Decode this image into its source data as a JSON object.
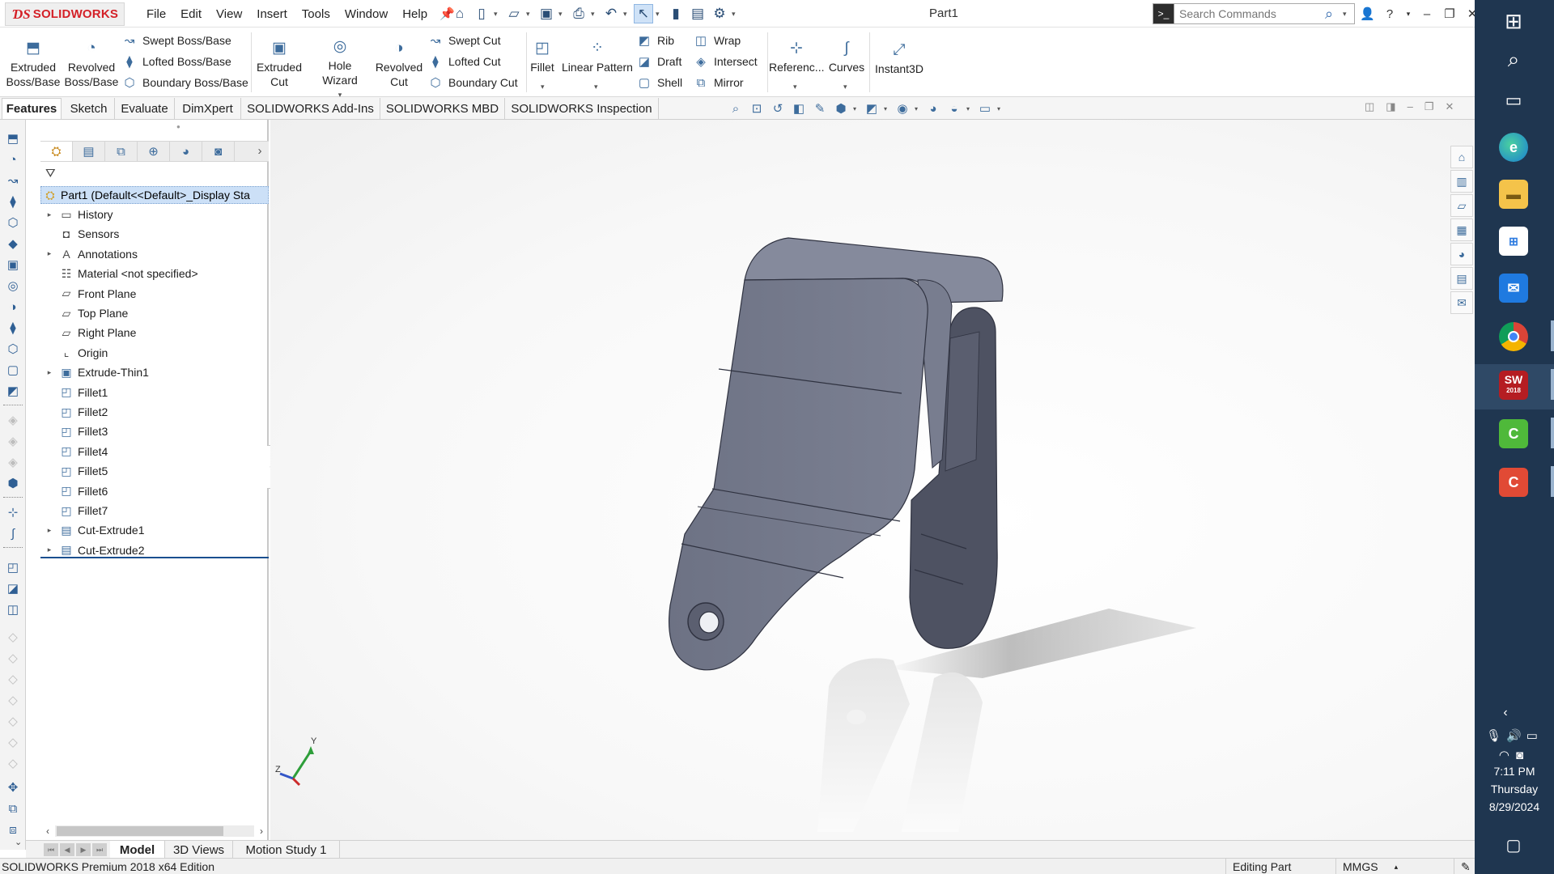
{
  "app": {
    "brand": "SOLIDWORKS",
    "document_title": "Part1",
    "menu": [
      "File",
      "Edit",
      "View",
      "Insert",
      "Tools",
      "Window",
      "Help"
    ],
    "search_placeholder": "Search Commands",
    "colors": {
      "brand_red": "#d42027",
      "selection_blue": "#cce0f7",
      "taskbar": "#1f3650",
      "model_gray": "#72778a"
    }
  },
  "ribbon": {
    "extruded_boss": "Extruded Boss/Base",
    "revolved_boss": "Revolved Boss/Base",
    "swept_boss": "Swept Boss/Base",
    "lofted_boss": "Lofted Boss/Base",
    "boundary_boss": "Boundary Boss/Base",
    "extruded_cut": "Extruded Cut",
    "hole_wizard": "Hole Wizard",
    "revolved_cut": "Revolved Cut",
    "swept_cut": "Swept Cut",
    "lofted_cut": "Lofted Cut",
    "boundary_cut": "Boundary Cut",
    "fillet": "Fillet",
    "linear_pattern": "Linear Pattern",
    "rib": "Rib",
    "draft": "Draft",
    "shell": "Shell",
    "wrap": "Wrap",
    "intersect": "Intersect",
    "mirror": "Mirror",
    "reference": "Referenc...",
    "curves": "Curves",
    "instant3d": "Instant3D"
  },
  "tabs": [
    "Features",
    "Sketch",
    "Evaluate",
    "DimXpert",
    "SOLIDWORKS Add-Ins",
    "SOLIDWORKS MBD",
    "SOLIDWORKS Inspection"
  ],
  "feature_tree": {
    "root": "Part1  (Default<<Default>_Display Sta",
    "items": [
      {
        "label": "History",
        "icon": "history-folder-icon",
        "expandable": true
      },
      {
        "label": "Sensors",
        "icon": "sensors-icon",
        "expandable": false
      },
      {
        "label": "Annotations",
        "icon": "annotations-icon",
        "expandable": true
      },
      {
        "label": "Material <not specified>",
        "icon": "material-icon",
        "expandable": false
      },
      {
        "label": "Front Plane",
        "icon": "plane-icon",
        "expandable": false
      },
      {
        "label": "Top Plane",
        "icon": "plane-icon",
        "expandable": false
      },
      {
        "label": "Right Plane",
        "icon": "plane-icon",
        "expandable": false
      },
      {
        "label": "Origin",
        "icon": "origin-icon",
        "expandable": false
      },
      {
        "label": "Extrude-Thin1",
        "icon": "extrude-icon",
        "expandable": true
      },
      {
        "label": "Fillet1",
        "icon": "fillet-icon",
        "expandable": false
      },
      {
        "label": "Fillet2",
        "icon": "fillet-icon",
        "expandable": false
      },
      {
        "label": "Fillet3",
        "icon": "fillet-icon",
        "expandable": false
      },
      {
        "label": "Fillet4",
        "icon": "fillet-icon",
        "expandable": false
      },
      {
        "label": "Fillet5",
        "icon": "fillet-icon",
        "expandable": false
      },
      {
        "label": "Fillet6",
        "icon": "fillet-icon",
        "expandable": false
      },
      {
        "label": "Fillet7",
        "icon": "fillet-icon",
        "expandable": false
      },
      {
        "label": "Cut-Extrude1",
        "icon": "cut-extrude-icon",
        "expandable": true
      },
      {
        "label": "Cut-Extrude2",
        "icon": "cut-extrude-icon",
        "expandable": true
      }
    ]
  },
  "bottom_tabs": [
    "Model",
    "3D Views",
    "Motion Study 1"
  ],
  "status": {
    "edition": "SOLIDWORKS Premium 2018 x64 Edition",
    "mode": "Editing Part",
    "units": "MMGS"
  },
  "triad": {
    "y": "Y",
    "z": "Z"
  },
  "taskbar": {
    "time": "7:11 PM",
    "day": "Thursday",
    "date": "8/29/2024",
    "sw_badge": "SW",
    "sw_year": "2018"
  }
}
